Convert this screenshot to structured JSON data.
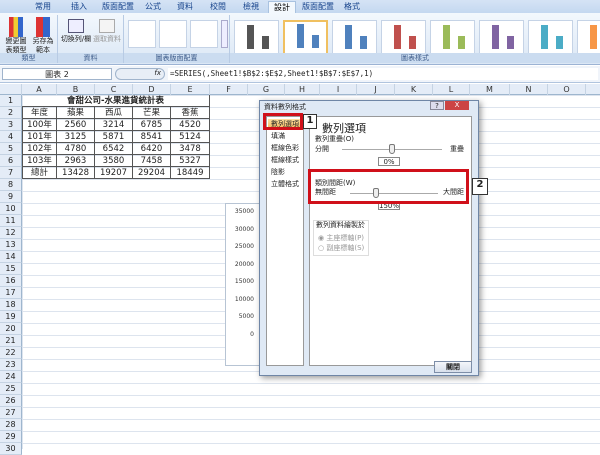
{
  "ribbon": {
    "tabs": [
      "常用",
      "插入",
      "版面配置",
      "公式",
      "資料",
      "校閱",
      "檢視",
      "設計",
      "版面配置",
      "格式"
    ],
    "active_tab": "設計",
    "buttons": {
      "change_type": "變更圖表類型",
      "save_template": "另存為範本",
      "switch_row_col": "切換列/欄",
      "select_data": "選取資料"
    },
    "groups": {
      "type": "類型",
      "data": "資料",
      "layouts": "圖表版面配置",
      "styles": "圖表樣式"
    },
    "style_colors": [
      "#555555",
      "#4f81bd",
      "#4f81bd",
      "#c0504d",
      "#9bbb59",
      "#8064a2",
      "#4bacc6",
      "#f79646"
    ]
  },
  "formula_bar": {
    "name_box": "圖表 2",
    "fx": "fx",
    "formula": "=SERIES(,Sheet1!$B$2:$E$2,Sheet1!$B$7:$E$7,1)"
  },
  "columns": [
    "A",
    "B",
    "C",
    "D",
    "E",
    "F",
    "G",
    "H",
    "I",
    "J",
    "K",
    "L",
    "M",
    "N",
    "O"
  ],
  "sheet": {
    "title": "會甜公司-水果進貨統計表",
    "header": [
      "年度",
      "蘋果",
      "西瓜",
      "芒果",
      "香蕉"
    ],
    "rows": [
      [
        "100年",
        "2560",
        "3214",
        "6785",
        "4520"
      ],
      [
        "101年",
        "3125",
        "5871",
        "8541",
        "5124"
      ],
      [
        "102年",
        "4780",
        "6542",
        "6420",
        "3478"
      ],
      [
        "103年",
        "2963",
        "3580",
        "7458",
        "5327"
      ],
      [
        "總計",
        "13428",
        "19207",
        "29204",
        "18449"
      ]
    ]
  },
  "chart": {
    "y_ticks": [
      "35000",
      "30000",
      "25000",
      "20000",
      "15000",
      "10000",
      "5000",
      "0"
    ]
  },
  "dialog": {
    "title": "資料數列格式",
    "help": "?",
    "close_x": "X",
    "nav": [
      "數列選項",
      "填滿",
      "框線色彩",
      "框線樣式",
      "陰影",
      "立體格式"
    ],
    "panel_title": "數列選項",
    "overlap": {
      "label": "數列重疊(O)",
      "left": "分開",
      "right": "重疊",
      "value": "0%",
      "level": 0.5
    },
    "gap": {
      "label": "類別間距(W)",
      "left": "無間距",
      "right": "大間距",
      "value": "150%",
      "level": 0.3
    },
    "plot_on": {
      "label": "數列資料繪製於",
      "primary": "主座標軸(P)",
      "secondary": "副座標軸(S)"
    },
    "close_button": "關閉"
  },
  "callouts": [
    "1",
    "2"
  ]
}
